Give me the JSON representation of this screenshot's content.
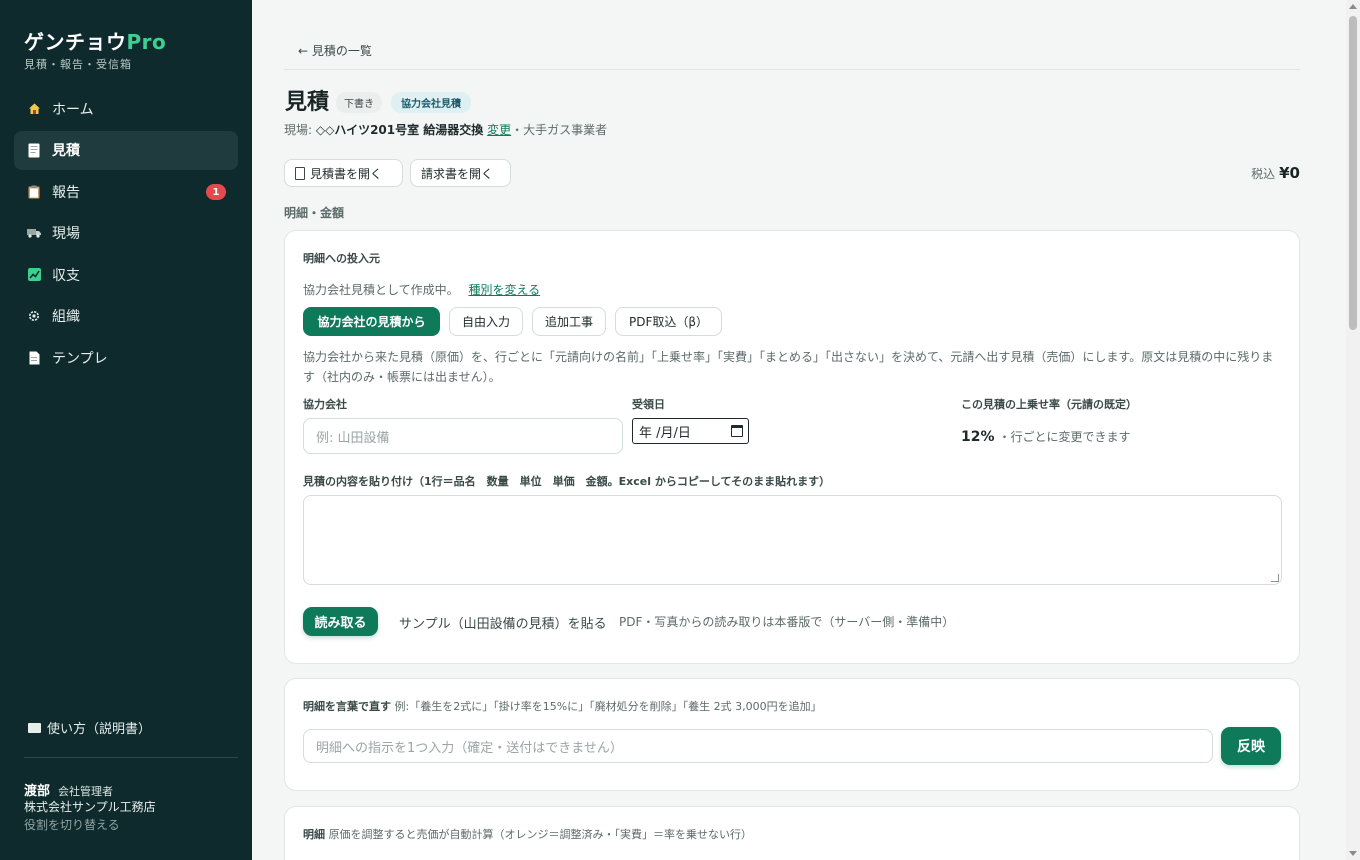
{
  "sidebar": {
    "brand_main": "ゲンチョウ",
    "brand_pro": "Pro",
    "brand_sub": "見積・報告・受信箱",
    "items": [
      {
        "label": "ホーム",
        "icon": "home-icon",
        "active": false
      },
      {
        "label": "見積",
        "icon": "document-icon",
        "active": true
      },
      {
        "label": "報告",
        "icon": "clipboard-icon",
        "active": false,
        "badge": "1"
      },
      {
        "label": "現場",
        "icon": "truck-icon",
        "active": false
      },
      {
        "label": "収支",
        "icon": "chart-icon",
        "active": false
      },
      {
        "label": "組織",
        "icon": "gear-icon",
        "active": false
      },
      {
        "label": "テンプレ",
        "icon": "template-icon",
        "active": false
      }
    ],
    "help": "使い方（説明書）",
    "user": {
      "name": "渡部",
      "role": "会社管理者",
      "company": "株式会社サンプル工務店",
      "switch_role": "役割を切り替える"
    }
  },
  "main": {
    "back_link": "← 見積の一覧",
    "title": "見積",
    "tag_draft": "下書き",
    "tag_partner": "協力会社見積",
    "site_prefix": "現場: ",
    "site_name": "◇◇ハイツ201号室 給湯器交換",
    "site_change": "変更",
    "site_suffix": "・大手ガス事業者",
    "open_quote": "見積書を開く",
    "open_invoice": "請求書を開く",
    "total_label": "税込",
    "total_amount": "¥0",
    "section_label": "明細・金額",
    "source_card": {
      "label": "明細への投入元",
      "status": "協力会社見積として作成中。",
      "change_type": "種別を変える",
      "modes": [
        "協力会社の見積から",
        "自由入力",
        "追加工事",
        "PDF取込（β）"
      ],
      "description": "協力会社から来た見積（原価）を、行ごとに「元請向けの名前」「上乗せ率」「実費」「まとめる」「出さない」を決めて、元請へ出す見積（売価）にします。原文は見積の中に残ります（社内のみ・帳票には出ません）。",
      "partner_label": "協力会社",
      "partner_placeholder": "例: 山田設備",
      "received_label": "受領日",
      "received_value": "年 /月/日",
      "rate_label": "この見積の上乗せ率（元請の既定）",
      "rate_value": "12%",
      "rate_note": "・行ごとに変更できます",
      "paste_label": "見積の内容を貼り付け（1行＝品名　数量　単位　単価　金額。Excel からコピーしてそのまま貼れます）",
      "read_button": "読み取る",
      "sample_link": "サンプル（山田設備の見積）を貼る",
      "pdf_note": "PDF・写真からの読み取りは本番版で（サーバー側・準備中）"
    },
    "instruct_card": {
      "label": "明細を言葉で直す",
      "examples": "例:「養生を2式に」「掛け率を15%に」「廃材処分を削除」「養生 2式 3,000円を追加」",
      "placeholder": "明細への指示を1つ入力（確定・送付はできません）",
      "apply_button": "反映"
    },
    "detail_card": {
      "label": "明細",
      "note": "原価を調整すると売価が自動計算（オレンジ＝調整済み・「実費」＝率を乗せない行）"
    }
  },
  "colors": {
    "sidebar_bg": "#0f2a2c",
    "accent": "#0f7a5a",
    "brand_pro": "#3ecf8e",
    "badge": "#e5484d"
  }
}
